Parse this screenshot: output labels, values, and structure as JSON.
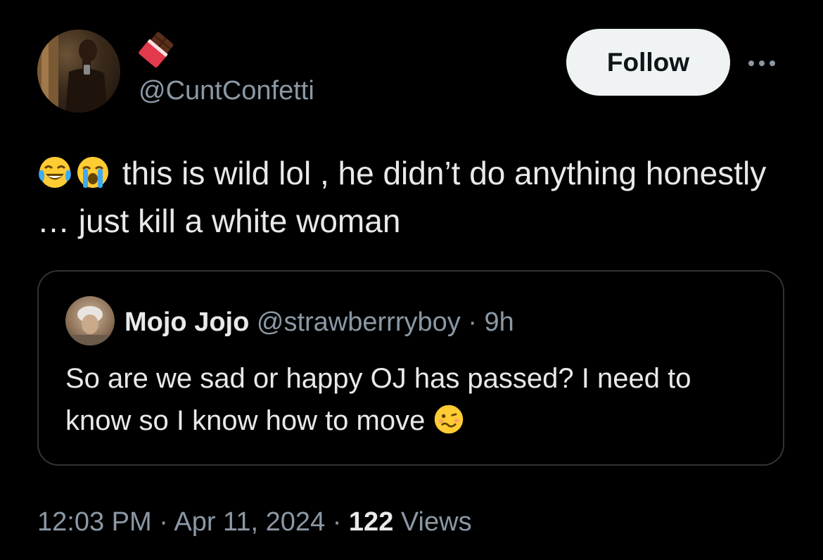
{
  "author": {
    "handle": "@CuntConfetti",
    "display_name_icon": "chocolate-bar-emoji"
  },
  "follow_label": "Follow",
  "more_icon": "ellipsis-icon",
  "tweet": {
    "emojis": [
      "face-with-tears-of-joy",
      "loudly-crying-face"
    ],
    "text": "this is wild lol , he didn’t do anything honestly … just kill a white woman"
  },
  "quote": {
    "name": "Mojo Jojo",
    "handle": "@strawberrryboy",
    "separator": "·",
    "time": "9h",
    "text": "So are we sad or happy OJ has passed? I need to know so I know how to move",
    "trailing_emoji": "woozy-face"
  },
  "footer": {
    "time": "12:03 PM",
    "sep1": "·",
    "date": "Apr 11, 2024",
    "sep2": "·",
    "views_count": "122",
    "views_label": "Views"
  },
  "colors": {
    "background": "#000000",
    "text": "#e7e9ea",
    "secondary": "#8b98a5",
    "follow_bg": "#eff3f4",
    "border": "#2f3336"
  }
}
